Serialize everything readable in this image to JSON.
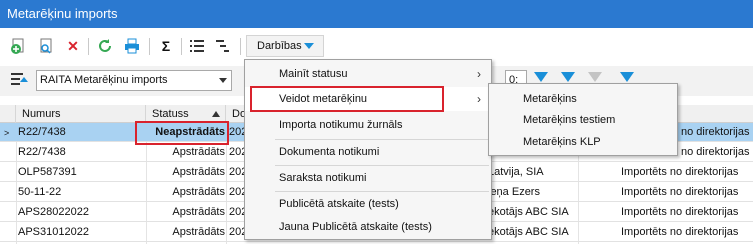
{
  "window": {
    "title": "Metarēķinu imports"
  },
  "toolbar": {
    "actions_label": "Darbības",
    "icons": [
      "add-icon",
      "view-icon",
      "delete-icon",
      "refresh-icon",
      "print-icon",
      "sum-icon",
      "list-view-icon",
      "tree-view-icon"
    ],
    "sum_glyph": "Σ",
    "delete_glyph": "✕"
  },
  "filter": {
    "selected_profile": "RAITA Metarēķinu imports",
    "stepper_value": "0:"
  },
  "grid": {
    "headers": {
      "number": "Numurs",
      "status": "Statuss",
      "date": "Do"
    },
    "rows": [
      {
        "number": "R22/7438",
        "status": "Neapstrādāts",
        "c3": "202",
        "c4": "",
        "c5": "no direktorijas",
        "selected": true
      },
      {
        "number": "R22/7438",
        "status": "Apstrādāts",
        "c3": "202",
        "c4": "",
        "c5": "no direktorijas"
      },
      {
        "number": "OLP587391",
        "status": "Apstrādāts",
        "c3": "202",
        "c4": "Latvija, SIA",
        "c5": "Importēts no direktorijas"
      },
      {
        "number": "50-11-22",
        "status": "Apstrādāts",
        "c3": "202",
        "c4": "ieņa Ezers",
        "c5": "Importēts no direktorijas"
      },
      {
        "number": "APS28022022",
        "status": "Apstrādāts",
        "c3": "202",
        "c4": "ekotājs ABC SIA",
        "c5": "Importēts no direktorijas"
      },
      {
        "number": "APS31012022",
        "status": "Apstrādāts",
        "c3": "202",
        "c4": "ekotājs ABC SIA",
        "c5": "Importēts no direktorijas"
      }
    ]
  },
  "menu": {
    "items": [
      {
        "label": "Mainīt statusu",
        "has_sub": true
      },
      {
        "label": "Veidot metarēķinu",
        "has_sub": true,
        "active": true
      },
      {
        "label": "Importa notikumu žurnāls"
      },
      {
        "label": "Dokumenta notikumi"
      },
      {
        "label": "Saraksta notikumi"
      },
      {
        "label": "Publicētā atskaite (tests)"
      },
      {
        "label": "Jauna Publicētā atskaite (tests)"
      }
    ],
    "chevron": "›"
  },
  "submenu": {
    "items": [
      "Metarēķins",
      "Metarēķins testiem",
      "Metarēķins KLP"
    ]
  },
  "colors": {
    "title_bar": "#2b79d0",
    "selected_row": "#a9d2f2",
    "highlight_border": "#d9232d",
    "accent": "#1a8fd8"
  }
}
